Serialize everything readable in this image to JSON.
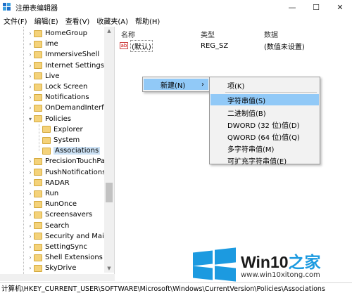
{
  "window": {
    "title": "注册表编辑器",
    "controls": [
      "—",
      "☐",
      "✕"
    ]
  },
  "menubar": [
    "文件(F)",
    "编辑(E)",
    "查看(V)",
    "收藏夹(A)",
    "帮助(H)"
  ],
  "tree": [
    {
      "label": "HomeGroup",
      "expanded": false
    },
    {
      "label": "ime",
      "expanded": false
    },
    {
      "label": "ImmersiveShell",
      "expanded": false
    },
    {
      "label": "Internet Settings",
      "expanded": false
    },
    {
      "label": "Live",
      "expanded": false
    },
    {
      "label": "Lock Screen",
      "expanded": false
    },
    {
      "label": "Notifications",
      "expanded": false
    },
    {
      "label": "OnDemandInterfac",
      "expanded": false
    },
    {
      "label": "Policies",
      "expanded": true
    },
    {
      "label": "Explorer",
      "child": true
    },
    {
      "label": "System",
      "child": true
    },
    {
      "label": "Associations",
      "child": true,
      "selected": true
    },
    {
      "label": "PrecisionTouchPac",
      "expanded": false
    },
    {
      "label": "PushNotifications",
      "expanded": false
    },
    {
      "label": "RADAR",
      "expanded": false
    },
    {
      "label": "Run",
      "expanded": false
    },
    {
      "label": "RunOnce",
      "expanded": false
    },
    {
      "label": "Screensavers",
      "expanded": false
    },
    {
      "label": "Search",
      "expanded": false
    },
    {
      "label": "Security and Maint",
      "expanded": false
    },
    {
      "label": "SettingSync",
      "expanded": false
    },
    {
      "label": "Shell Extensions",
      "expanded": false
    },
    {
      "label": "SkyDrive",
      "expanded": false
    }
  ],
  "list": {
    "headers": [
      "名称",
      "类型",
      "数据"
    ],
    "rows": [
      {
        "icon": "ab",
        "name": "(默认)",
        "type": "REG_SZ",
        "data": "(数值未设置)"
      }
    ]
  },
  "context_menu": {
    "label": "新建(N)",
    "arrow": "›"
  },
  "submenu": [
    "项(K)",
    "字符串值(S)",
    "二进制值(B)",
    "DWORD (32 位)值(D)",
    "QWORD (64 位)值(Q)",
    "多字符串值(M)",
    "可扩充字符串值(E)"
  ],
  "submenu_highlight": 1,
  "statusbar": "计算机\\HKEY_CURRENT_USER\\SOFTWARE\\Microsoft\\Windows\\CurrentVersion\\Policies\\Associations",
  "watermark": {
    "brand_dark": "Win10",
    "brand_blue": "之家",
    "url": "www.win10xitong.com"
  },
  "colors": {
    "highlight": "#91c9f7",
    "folder": "#f4d27a",
    "accent": "#1c9ae0"
  }
}
